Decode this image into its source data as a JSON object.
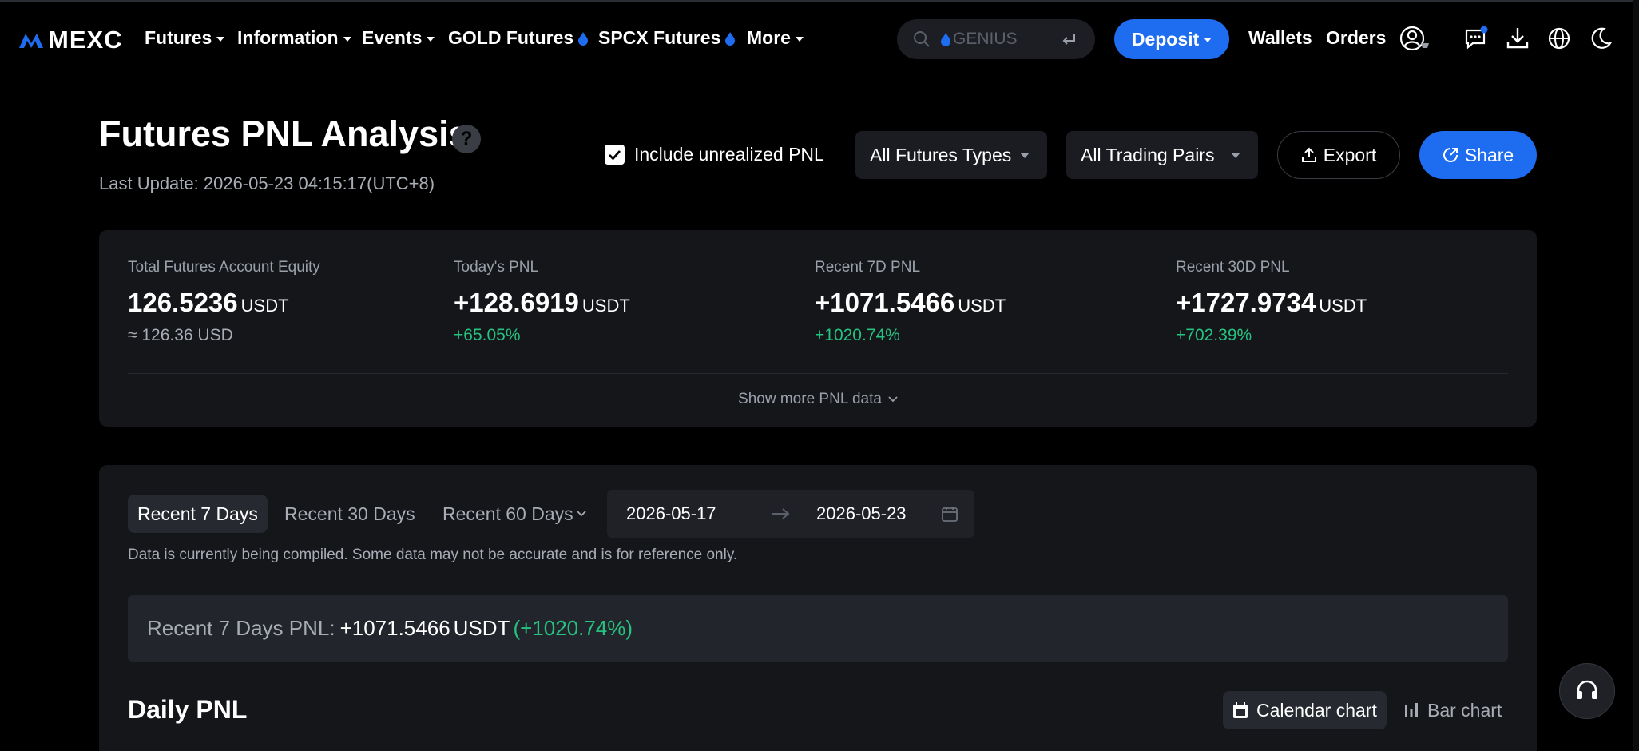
{
  "nav": {
    "logo": "MEXC",
    "items": [
      {
        "label": "Futures",
        "dropdown": true
      },
      {
        "label": "Information",
        "dropdown": true
      },
      {
        "label": "Events",
        "dropdown": true
      },
      {
        "label": "GOLD Futures",
        "hot": true
      },
      {
        "label": "SPCX Futures",
        "hot": true
      },
      {
        "label": "More",
        "dropdown": true
      }
    ],
    "search_placeholder": "GENIUS",
    "deposit": "Deposit",
    "wallets": "Wallets",
    "orders": "Orders"
  },
  "header": {
    "title": "Futures PNL Analysis",
    "help": "?",
    "last_update": "Last Update: 2026-05-23 04:15:17(UTC+8)",
    "include_unrealized": "Include unrealized PNL",
    "futures_types": "All Futures Types",
    "trading_pairs": "All Trading Pairs",
    "export": "Export",
    "share": "Share"
  },
  "summary": {
    "equity": {
      "label": "Total Futures Account Equity",
      "value": "126.5236",
      "unit": "USDT",
      "sub": "≈ 126.36 USD"
    },
    "today": {
      "label": "Today's PNL",
      "value": "+128.6919",
      "unit": "USDT",
      "sub": "+65.05%"
    },
    "d7": {
      "label": "Recent 7D PNL",
      "value": "+1071.5466",
      "unit": "USDT",
      "sub": "+1020.74%"
    },
    "d30": {
      "label": "Recent 30D PNL",
      "value": "+1727.9734",
      "unit": "USDT",
      "sub": "+702.39%"
    },
    "show_more": "Show more PNL data"
  },
  "range": {
    "tabs": [
      "Recent 7 Days",
      "Recent 30 Days",
      "Recent 60 Days"
    ],
    "start": "2026-05-17",
    "end": "2026-05-23",
    "note": "Data is currently being compiled. Some data may not be accurate and is for reference only.",
    "pnl_label": "Recent 7 Days PNL:",
    "pnl_value": "+1071.5466",
    "pnl_unit": "USDT",
    "pnl_pct": "(+1020.74%)"
  },
  "daily": {
    "title": "Daily PNL",
    "calendar": "Calendar chart",
    "bar": "Bar chart"
  },
  "colors": {
    "accent": "#1e6cf0",
    "positive": "#26c280",
    "card": "#14161a"
  }
}
